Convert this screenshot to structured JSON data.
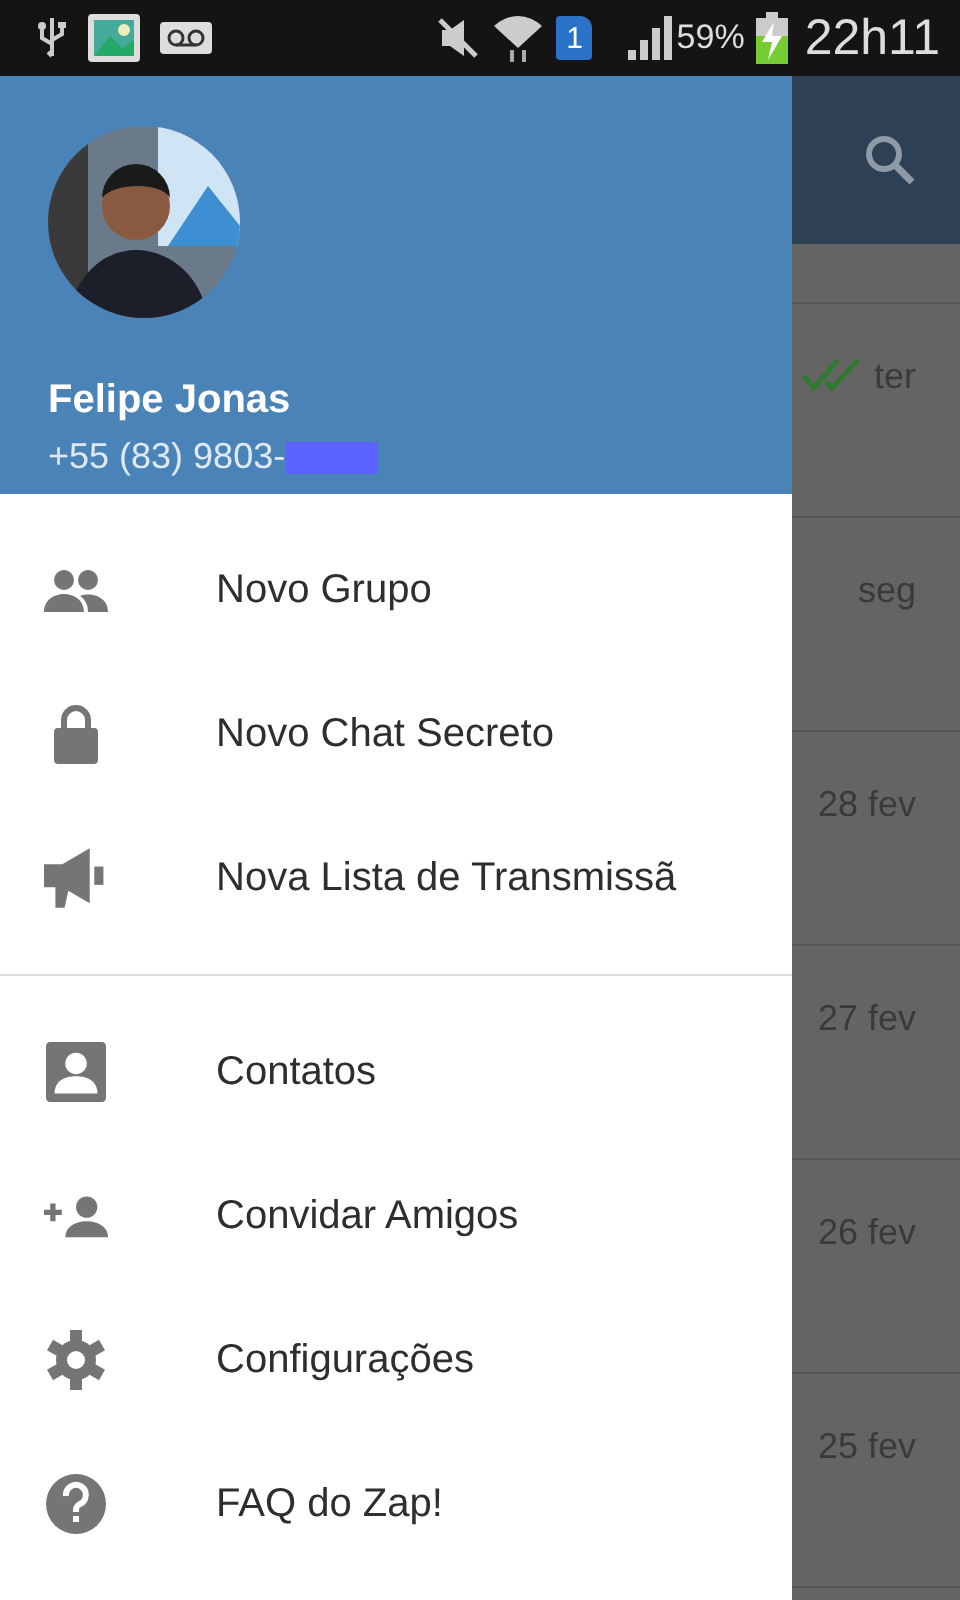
{
  "status_bar": {
    "sim": "1",
    "battery": "59%",
    "time": "22h11"
  },
  "drawer": {
    "profile": {
      "name": "Felipe Jonas",
      "phone": "+55 (83) 9803-",
      "phone_redacted": true
    },
    "menu_groups": [
      [
        {
          "kind": "group",
          "label": "Novo Grupo"
        },
        {
          "kind": "lock",
          "label": "Novo Chat Secreto"
        },
        {
          "kind": "megaphone",
          "label": "Nova Lista de Transmissã"
        }
      ],
      [
        {
          "kind": "contact",
          "label": "Contatos"
        },
        {
          "kind": "invite",
          "label": "Convidar Amigos"
        },
        {
          "kind": "settings",
          "label": "Configurações"
        },
        {
          "kind": "help",
          "label": "FAQ do Zap!"
        }
      ]
    ]
  },
  "chat_list": [
    {
      "date": "ter",
      "read": true
    },
    {
      "date": "seg",
      "read": false
    },
    {
      "date": "28 fev",
      "read": false
    },
    {
      "date": "27 fev",
      "read": false
    },
    {
      "date": "26 fev",
      "read": false
    },
    {
      "date": "25 fev",
      "read": false
    }
  ]
}
